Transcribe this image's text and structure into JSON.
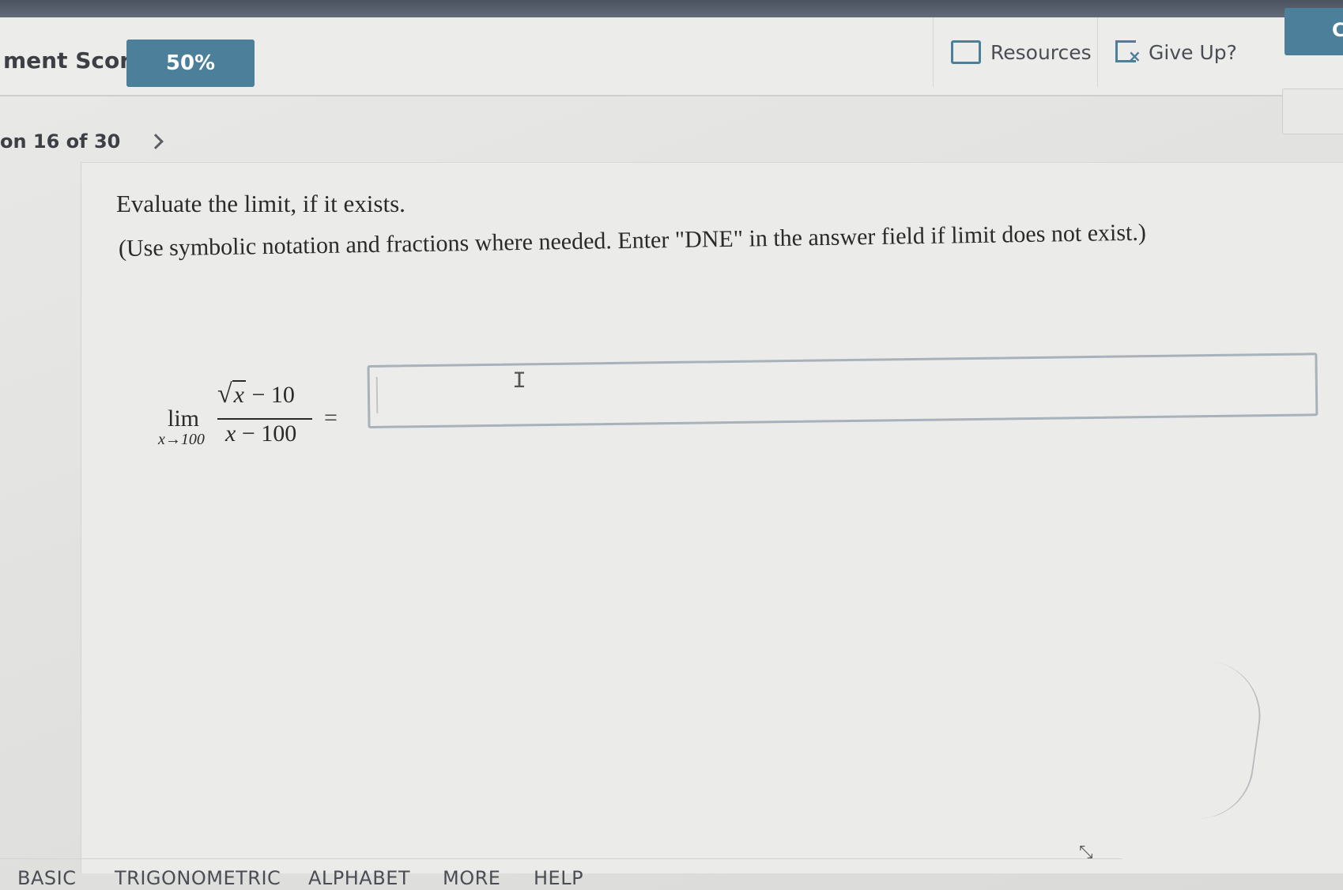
{
  "header": {
    "score_label": "ment Score:",
    "score_value": "50%",
    "resources_label": "Resources",
    "giveup_label": "Give Up?",
    "check_label": "Cl"
  },
  "nav": {
    "question_progress": "on 16 of 30"
  },
  "question": {
    "title": "Evaluate the limit, if it exists.",
    "instructions": "(Use symbolic notation and fractions where needed. Enter \"DNE\" in the answer field if limit does not exist.)",
    "math": {
      "lim": "lim",
      "lim_sub": "x→100",
      "numerator_sqrt_var": "x",
      "numerator_rest": " − 10",
      "denominator_var": "x",
      "denominator_rest": " − 100",
      "equals": "="
    },
    "answer_value": ""
  },
  "keyboard_tabs": [
    "BASIC",
    "TRIGONOMETRIC",
    "ALPHABET",
    "MORE",
    "HELP"
  ],
  "colors": {
    "accent": "#4c7f99",
    "background": "#e6e6e4",
    "text": "#2a2a2a"
  },
  "icons": [
    "folder-icon",
    "give-up-icon",
    "chevron-right-icon",
    "collapse-icon"
  ]
}
